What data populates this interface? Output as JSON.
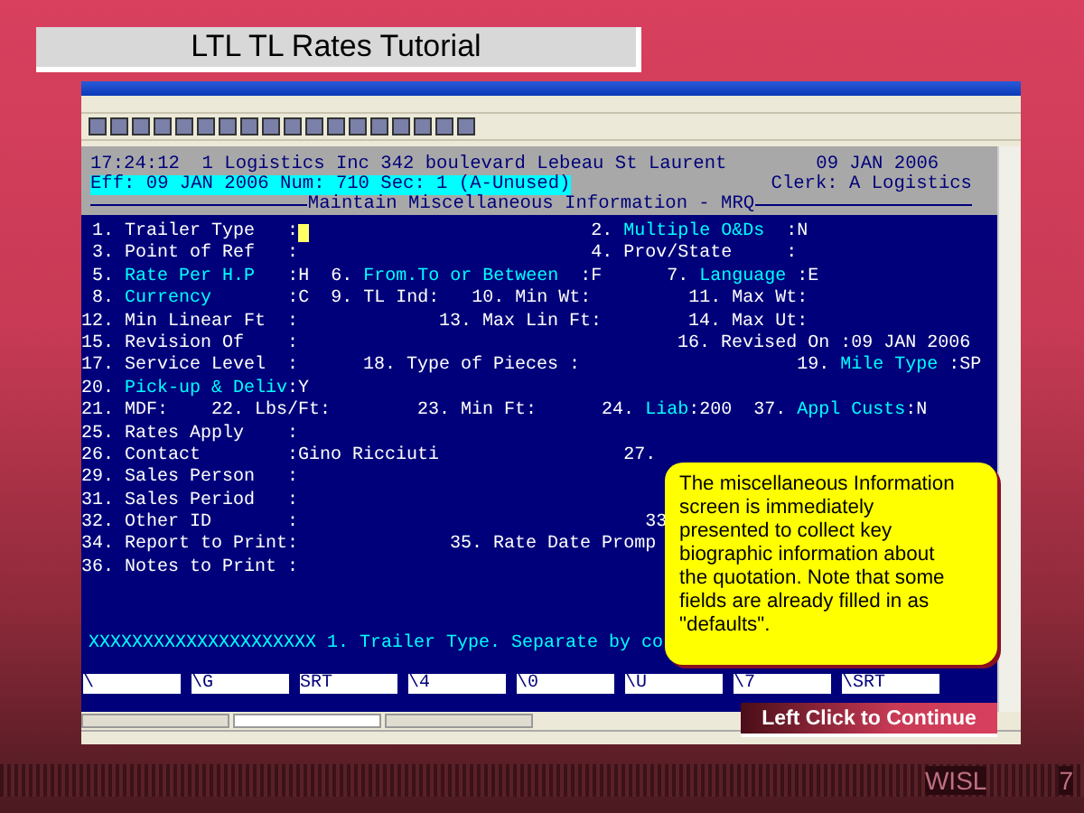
{
  "slide_title": "LTL TL Rates Tutorial",
  "terminal": {
    "header_line": "17:24:12  1 Logistics Inc 342 boulevard Lebeau St Laurent        09 JAN 2006",
    "eff_line": "Eff: 09 JAN 2006 Num: 710 Sec: 1 (A-Unused)",
    "clerk": "Clerk: A Logistics",
    "screen_title": "Maintain Miscellaneous Information - MRQ",
    "lines": [
      {
        "parts": [
          {
            "kind": "plain",
            "text": " 1. Trailer Type   :"
          },
          {
            "kind": "cursor"
          },
          {
            "kind": "plain",
            "text": "                          2. "
          },
          {
            "kind": "highlight",
            "text": "Multiple O&Ds"
          },
          {
            "kind": "plain",
            "text": "  :N"
          }
        ]
      },
      {
        "parts": [
          {
            "kind": "plain",
            "text": " 3. Point of Ref   :"
          },
          {
            "kind": "plain",
            "text": "                           4. Prov/State     :"
          }
        ]
      },
      {
        "parts": [
          {
            "kind": "plain",
            "text": " 5. "
          },
          {
            "kind": "highlight",
            "text": "Rate Per H.P"
          },
          {
            "kind": "plain",
            "text": "   :H  6. "
          },
          {
            "kind": "highlight",
            "text": "From.To or Between"
          },
          {
            "kind": "plain",
            "text": "  :F      7. "
          },
          {
            "kind": "highlight",
            "text": "Language"
          },
          {
            "kind": "plain",
            "text": " :E"
          }
        ]
      },
      {
        "parts": [
          {
            "kind": "plain",
            "text": " 8. "
          },
          {
            "kind": "highlight",
            "text": "Currency"
          },
          {
            "kind": "plain",
            "text": "       :C  9. TL Ind:   10. Min Wt:         11. Max Wt:"
          }
        ]
      },
      {
        "parts": [
          {
            "kind": "plain",
            "text": "12. Min Linear Ft  :             13. Max Lin Ft:        14. Max Ut:"
          }
        ]
      },
      {
        "parts": [
          {
            "kind": "plain",
            "text": "15. Revision Of    :                                   16. Revised On :09 JAN 2006"
          }
        ]
      },
      {
        "parts": [
          {
            "kind": "plain",
            "text": "17. Service Level  :      18. Type of Pieces :                    19. "
          },
          {
            "kind": "highlight",
            "text": "Mile Type"
          },
          {
            "kind": "plain",
            "text": " :SP"
          }
        ]
      },
      {
        "parts": [
          {
            "kind": "plain",
            "text": "20. "
          },
          {
            "kind": "highlight",
            "text": "Pick-up & Deliv"
          },
          {
            "kind": "plain",
            "text": ":Y"
          }
        ]
      },
      {
        "parts": [
          {
            "kind": "plain",
            "text": "21. MDF:    22. Lbs/Ft:        23. Min Ft:      24. "
          },
          {
            "kind": "highlight",
            "text": "Liab"
          },
          {
            "kind": "plain",
            "text": ":200  37. "
          },
          {
            "kind": "highlight",
            "text": "Appl Custs"
          },
          {
            "kind": "plain",
            "text": ":N"
          }
        ]
      },
      {
        "parts": [
          {
            "kind": "plain",
            "text": "25. Rates Apply    :"
          }
        ]
      },
      {
        "parts": [
          {
            "kind": "plain",
            "text": "26. Contact        :Gino Ricciuti"
          },
          {
            "kind": "plain",
            "text": "                 27."
          }
        ]
      },
      {
        "parts": [
          {
            "kind": "plain",
            "text": "29. Sales Person   :"
          }
        ]
      },
      {
        "parts": [
          {
            "kind": "plain",
            "text": "31. Sales Period   :"
          }
        ]
      },
      {
        "parts": [
          {
            "kind": "plain",
            "text": "32. Other ID       :"
          },
          {
            "kind": "plain",
            "text": "                                33"
          }
        ]
      },
      {
        "parts": [
          {
            "kind": "plain",
            "text": "34. Report to Print:"
          },
          {
            "kind": "plain",
            "text": "              35. Rate Date Promp"
          }
        ]
      },
      {
        "parts": [
          {
            "kind": "plain",
            "text": "36. Notes to Print :"
          }
        ]
      }
    ],
    "message": "XXXXXXXXXXXXXXXXXXXXX 1. Trailer Type. Separate by co",
    "function_keys": [
      "\\",
      "\\G",
      "SRT",
      "\\4",
      "\\0",
      "\\U",
      "\\7",
      "\\SRT"
    ]
  },
  "taskbar": [
    {
      "selected": false
    },
    {
      "selected": true
    },
    {
      "selected": false
    }
  ],
  "callout": "The miscellaneous Information screen is immediately presented to collect key biographic information about the quotation. Note that some fields are already filled in as \"defaults\".",
  "continue_button": "Left Click to Continue",
  "footer": {
    "left": "WISL",
    "page": "7"
  }
}
